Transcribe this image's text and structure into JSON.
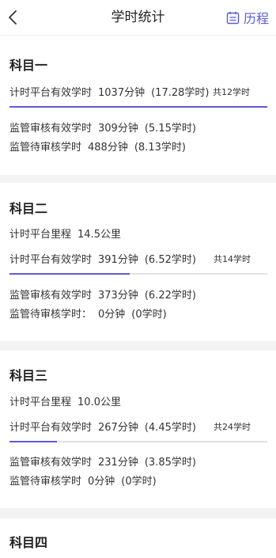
{
  "header": {
    "title": "学时统计",
    "history_label": "历程",
    "accent_color": "#5b5bd6"
  },
  "subjects": [
    {
      "title": "科目一",
      "platform_label": "计时平台有效学时",
      "platform_value": "1037分钟",
      "platform_hours": "(17.28学时)",
      "total_label": "共12学时",
      "progress": 1.0,
      "review_label": "监管审核有效学时",
      "review_value": "309分钟",
      "review_hours": "(5.15学时)",
      "pending_label": "监管待审核学时",
      "pending_value": "488分钟",
      "pending_hours": "(8.13学时)"
    },
    {
      "title": "科目二",
      "mileage_label": "计时平台里程",
      "mileage_value": "14.5公里",
      "platform_label": "计时平台有效学时",
      "platform_value": "391分钟",
      "platform_hours": "(6.52学时)",
      "total_label": "共14学时",
      "progress": 0.465,
      "review_label": "监管审核有效学时",
      "review_value": "373分钟",
      "review_hours": "(6.22学时)",
      "pending_label": "监管待审核学时：",
      "pending_value": "0分钟",
      "pending_hours": "(0学时)"
    },
    {
      "title": "科目三",
      "mileage_label": "计时平台里程",
      "mileage_value": "10.0公里",
      "platform_label": "计时平台有效学时",
      "platform_value": "267分钟",
      "platform_hours": "(4.45学时)",
      "total_label": "共24学时",
      "progress": 0.185,
      "review_label": "监管审核有效学时",
      "review_value": "231分钟",
      "review_hours": "(3.85学时)",
      "pending_label": "监管待审核学时",
      "pending_value": "0分钟",
      "pending_hours": "(0学时)"
    },
    {
      "title": "科目四"
    }
  ]
}
